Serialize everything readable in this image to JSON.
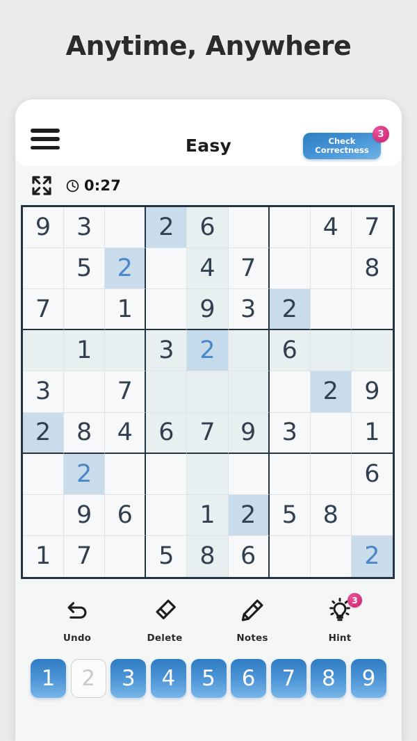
{
  "headline": "Anytime, Anywhere",
  "appbar": {
    "menu_icon": "hamburger-menu-icon",
    "title": "Easy",
    "check_button_label": "Check Correctness",
    "check_badge_count": "3",
    "accent_blue": "#4391d4",
    "badge_pink": "#d9377f"
  },
  "statusbar": {
    "expand_icon": "fullscreen-expand-icon",
    "clock_icon": "clock-icon",
    "time": "0:27"
  },
  "board": {
    "selected": {
      "row": 4,
      "col": 5
    },
    "selected_value": "2",
    "cells": [
      [
        {
          "v": "9",
          "s": "given"
        },
        {
          "v": "3",
          "s": "given"
        },
        {
          "v": "",
          "s": "empty"
        },
        {
          "v": "2",
          "s": "peer"
        },
        {
          "v": "6",
          "s": "soft"
        },
        {
          "v": "",
          "s": "empty"
        },
        {
          "v": "",
          "s": "empty"
        },
        {
          "v": "4",
          "s": "given"
        },
        {
          "v": "7",
          "s": "given"
        }
      ],
      [
        {
          "v": "",
          "s": "empty"
        },
        {
          "v": "5",
          "s": "given"
        },
        {
          "v": "2",
          "s": "peer-user"
        },
        {
          "v": "",
          "s": "empty"
        },
        {
          "v": "4",
          "s": "soft"
        },
        {
          "v": "7",
          "s": "given"
        },
        {
          "v": "",
          "s": "empty"
        },
        {
          "v": "",
          "s": "empty"
        },
        {
          "v": "8",
          "s": "given"
        }
      ],
      [
        {
          "v": "7",
          "s": "given"
        },
        {
          "v": "",
          "s": "empty"
        },
        {
          "v": "1",
          "s": "given"
        },
        {
          "v": "",
          "s": "empty"
        },
        {
          "v": "9",
          "s": "soft"
        },
        {
          "v": "3",
          "s": "given"
        },
        {
          "v": "2",
          "s": "peer"
        },
        {
          "v": "",
          "s": "empty"
        },
        {
          "v": "",
          "s": "empty"
        }
      ],
      [
        {
          "v": "",
          "s": "soft"
        },
        {
          "v": "1",
          "s": "soft"
        },
        {
          "v": "",
          "s": "soft"
        },
        {
          "v": "3",
          "s": "soft"
        },
        {
          "v": "2",
          "s": "selected-user"
        },
        {
          "v": "",
          "s": "soft"
        },
        {
          "v": "6",
          "s": "soft"
        },
        {
          "v": "",
          "s": "soft"
        },
        {
          "v": "",
          "s": "soft"
        }
      ],
      [
        {
          "v": "3",
          "s": "given"
        },
        {
          "v": "",
          "s": "empty"
        },
        {
          "v": "7",
          "s": "given"
        },
        {
          "v": "",
          "s": "soft"
        },
        {
          "v": "",
          "s": "soft"
        },
        {
          "v": "",
          "s": "soft"
        },
        {
          "v": "",
          "s": "empty"
        },
        {
          "v": "2",
          "s": "peer"
        },
        {
          "v": "9",
          "s": "given"
        }
      ],
      [
        {
          "v": "2",
          "s": "peer"
        },
        {
          "v": "8",
          "s": "given"
        },
        {
          "v": "4",
          "s": "given"
        },
        {
          "v": "6",
          "s": "soft"
        },
        {
          "v": "7",
          "s": "soft"
        },
        {
          "v": "9",
          "s": "soft"
        },
        {
          "v": "3",
          "s": "given"
        },
        {
          "v": "",
          "s": "empty"
        },
        {
          "v": "1",
          "s": "given"
        }
      ],
      [
        {
          "v": "",
          "s": "empty"
        },
        {
          "v": "2",
          "s": "peer-user"
        },
        {
          "v": "",
          "s": "empty"
        },
        {
          "v": "",
          "s": "empty"
        },
        {
          "v": "",
          "s": "soft"
        },
        {
          "v": "",
          "s": "empty"
        },
        {
          "v": "",
          "s": "empty"
        },
        {
          "v": "",
          "s": "empty"
        },
        {
          "v": "6",
          "s": "given"
        }
      ],
      [
        {
          "v": "",
          "s": "empty"
        },
        {
          "v": "9",
          "s": "given"
        },
        {
          "v": "6",
          "s": "given"
        },
        {
          "v": "",
          "s": "empty"
        },
        {
          "v": "1",
          "s": "soft"
        },
        {
          "v": "2",
          "s": "peer"
        },
        {
          "v": "5",
          "s": "given"
        },
        {
          "v": "8",
          "s": "given"
        },
        {
          "v": "",
          "s": "empty"
        }
      ],
      [
        {
          "v": "1",
          "s": "given"
        },
        {
          "v": "7",
          "s": "given"
        },
        {
          "v": "",
          "s": "empty"
        },
        {
          "v": "5",
          "s": "given"
        },
        {
          "v": "8",
          "s": "soft"
        },
        {
          "v": "6",
          "s": "given"
        },
        {
          "v": "",
          "s": "empty"
        },
        {
          "v": "",
          "s": "empty"
        },
        {
          "v": "2",
          "s": "peer-user"
        }
      ]
    ]
  },
  "tools": [
    {
      "label": "Undo",
      "icon": "undo-arrow-icon",
      "badge": ""
    },
    {
      "label": "Delete",
      "icon": "eraser-icon",
      "badge": ""
    },
    {
      "label": "Notes",
      "icon": "pencil-icon",
      "badge": ""
    },
    {
      "label": "Hint",
      "icon": "lightbulb-icon",
      "badge": "3"
    }
  ],
  "numpad": [
    {
      "label": "1",
      "state": "active"
    },
    {
      "label": "2",
      "state": "done"
    },
    {
      "label": "3",
      "state": "active"
    },
    {
      "label": "4",
      "state": "active"
    },
    {
      "label": "5",
      "state": "active"
    },
    {
      "label": "6",
      "state": "active"
    },
    {
      "label": "7",
      "state": "active"
    },
    {
      "label": "8",
      "state": "active"
    },
    {
      "label": "9",
      "state": "active"
    }
  ]
}
